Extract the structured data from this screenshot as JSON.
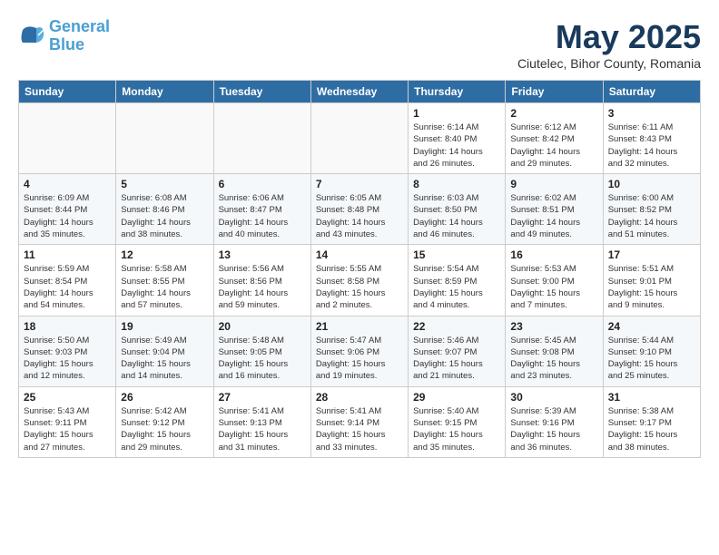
{
  "header": {
    "logo_line1": "General",
    "logo_line2": "Blue",
    "month": "May 2025",
    "location": "Ciutelec, Bihor County, Romania"
  },
  "weekdays": [
    "Sunday",
    "Monday",
    "Tuesday",
    "Wednesday",
    "Thursday",
    "Friday",
    "Saturday"
  ],
  "weeks": [
    [
      {
        "day": "",
        "info": ""
      },
      {
        "day": "",
        "info": ""
      },
      {
        "day": "",
        "info": ""
      },
      {
        "day": "",
        "info": ""
      },
      {
        "day": "1",
        "info": "Sunrise: 6:14 AM\nSunset: 8:40 PM\nDaylight: 14 hours\nand 26 minutes."
      },
      {
        "day": "2",
        "info": "Sunrise: 6:12 AM\nSunset: 8:42 PM\nDaylight: 14 hours\nand 29 minutes."
      },
      {
        "day": "3",
        "info": "Sunrise: 6:11 AM\nSunset: 8:43 PM\nDaylight: 14 hours\nand 32 minutes."
      }
    ],
    [
      {
        "day": "4",
        "info": "Sunrise: 6:09 AM\nSunset: 8:44 PM\nDaylight: 14 hours\nand 35 minutes."
      },
      {
        "day": "5",
        "info": "Sunrise: 6:08 AM\nSunset: 8:46 PM\nDaylight: 14 hours\nand 38 minutes."
      },
      {
        "day": "6",
        "info": "Sunrise: 6:06 AM\nSunset: 8:47 PM\nDaylight: 14 hours\nand 40 minutes."
      },
      {
        "day": "7",
        "info": "Sunrise: 6:05 AM\nSunset: 8:48 PM\nDaylight: 14 hours\nand 43 minutes."
      },
      {
        "day": "8",
        "info": "Sunrise: 6:03 AM\nSunset: 8:50 PM\nDaylight: 14 hours\nand 46 minutes."
      },
      {
        "day": "9",
        "info": "Sunrise: 6:02 AM\nSunset: 8:51 PM\nDaylight: 14 hours\nand 49 minutes."
      },
      {
        "day": "10",
        "info": "Sunrise: 6:00 AM\nSunset: 8:52 PM\nDaylight: 14 hours\nand 51 minutes."
      }
    ],
    [
      {
        "day": "11",
        "info": "Sunrise: 5:59 AM\nSunset: 8:54 PM\nDaylight: 14 hours\nand 54 minutes."
      },
      {
        "day": "12",
        "info": "Sunrise: 5:58 AM\nSunset: 8:55 PM\nDaylight: 14 hours\nand 57 minutes."
      },
      {
        "day": "13",
        "info": "Sunrise: 5:56 AM\nSunset: 8:56 PM\nDaylight: 14 hours\nand 59 minutes."
      },
      {
        "day": "14",
        "info": "Sunrise: 5:55 AM\nSunset: 8:58 PM\nDaylight: 15 hours\nand 2 minutes."
      },
      {
        "day": "15",
        "info": "Sunrise: 5:54 AM\nSunset: 8:59 PM\nDaylight: 15 hours\nand 4 minutes."
      },
      {
        "day": "16",
        "info": "Sunrise: 5:53 AM\nSunset: 9:00 PM\nDaylight: 15 hours\nand 7 minutes."
      },
      {
        "day": "17",
        "info": "Sunrise: 5:51 AM\nSunset: 9:01 PM\nDaylight: 15 hours\nand 9 minutes."
      }
    ],
    [
      {
        "day": "18",
        "info": "Sunrise: 5:50 AM\nSunset: 9:03 PM\nDaylight: 15 hours\nand 12 minutes."
      },
      {
        "day": "19",
        "info": "Sunrise: 5:49 AM\nSunset: 9:04 PM\nDaylight: 15 hours\nand 14 minutes."
      },
      {
        "day": "20",
        "info": "Sunrise: 5:48 AM\nSunset: 9:05 PM\nDaylight: 15 hours\nand 16 minutes."
      },
      {
        "day": "21",
        "info": "Sunrise: 5:47 AM\nSunset: 9:06 PM\nDaylight: 15 hours\nand 19 minutes."
      },
      {
        "day": "22",
        "info": "Sunrise: 5:46 AM\nSunset: 9:07 PM\nDaylight: 15 hours\nand 21 minutes."
      },
      {
        "day": "23",
        "info": "Sunrise: 5:45 AM\nSunset: 9:08 PM\nDaylight: 15 hours\nand 23 minutes."
      },
      {
        "day": "24",
        "info": "Sunrise: 5:44 AM\nSunset: 9:10 PM\nDaylight: 15 hours\nand 25 minutes."
      }
    ],
    [
      {
        "day": "25",
        "info": "Sunrise: 5:43 AM\nSunset: 9:11 PM\nDaylight: 15 hours\nand 27 minutes."
      },
      {
        "day": "26",
        "info": "Sunrise: 5:42 AM\nSunset: 9:12 PM\nDaylight: 15 hours\nand 29 minutes."
      },
      {
        "day": "27",
        "info": "Sunrise: 5:41 AM\nSunset: 9:13 PM\nDaylight: 15 hours\nand 31 minutes."
      },
      {
        "day": "28",
        "info": "Sunrise: 5:41 AM\nSunset: 9:14 PM\nDaylight: 15 hours\nand 33 minutes."
      },
      {
        "day": "29",
        "info": "Sunrise: 5:40 AM\nSunset: 9:15 PM\nDaylight: 15 hours\nand 35 minutes."
      },
      {
        "day": "30",
        "info": "Sunrise: 5:39 AM\nSunset: 9:16 PM\nDaylight: 15 hours\nand 36 minutes."
      },
      {
        "day": "31",
        "info": "Sunrise: 5:38 AM\nSunset: 9:17 PM\nDaylight: 15 hours\nand 38 minutes."
      }
    ]
  ]
}
